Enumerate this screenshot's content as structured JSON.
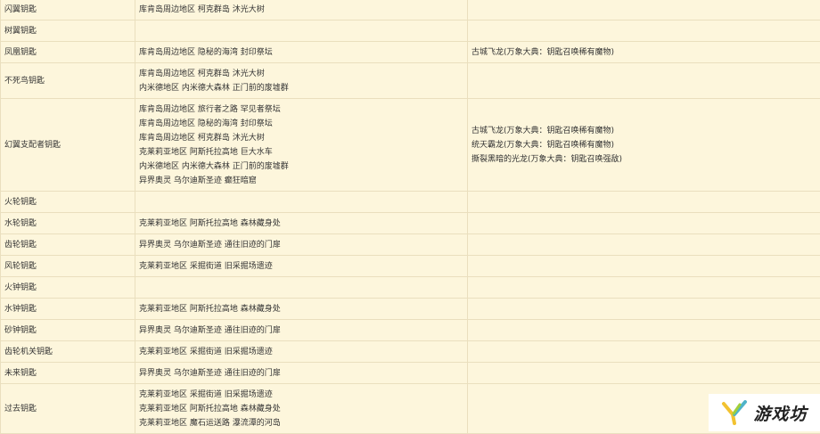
{
  "table": {
    "rows": [
      {
        "key": "闪翼钥匙",
        "locations": [
          "库肯岛周边地区 柯克群岛 沐光大树"
        ],
        "sources": []
      },
      {
        "key": "树翼钥匙",
        "locations": [],
        "sources": []
      },
      {
        "key": "凤凰钥匙",
        "locations": [
          "库肯岛周边地区 隐秘的海湾 封印祭坛"
        ],
        "sources": [
          "古城飞龙(万象大典：钥匙召唤稀有魔物)"
        ]
      },
      {
        "key": "不死鸟钥匙",
        "locations": [
          "库肯岛周边地区 柯克群岛 沐光大树",
          "内米德地区 内米德大森林 正门前的废墟群"
        ],
        "sources": []
      },
      {
        "key": "幻翼支配者钥匙",
        "locations": [
          "库肯岛周边地区 旅行者之路 罕见者祭坛",
          "库肯岛周边地区 隐秘的海湾 封印祭坛",
          "库肯岛周边地区 柯克群岛 沐光大树",
          "克莱莉亚地区 阿斯托拉高地 巨大水车",
          "内米德地区 内米德大森林 正门前的废墟群",
          "异界奥灵 乌尔迪斯圣迹 癫狂暗窟"
        ],
        "sources": [
          "古城飞龙(万象大典：钥匙召唤稀有魔物)",
          "统天霸龙(万象大典：钥匙召唤稀有魔物)",
          "撕裂黑暗的光龙(万象大典：钥匙召唤强敌)"
        ]
      },
      {
        "key": "火轮钥匙",
        "locations": [],
        "sources": []
      },
      {
        "key": "水轮钥匙",
        "locations": [
          "克莱莉亚地区 阿斯托拉高地 森林藏身处"
        ],
        "sources": []
      },
      {
        "key": "齿轮钥匙",
        "locations": [
          "异界奥灵 乌尔迪斯圣迹 通往旧迹的门扉"
        ],
        "sources": []
      },
      {
        "key": "风轮钥匙",
        "locations": [
          "克莱莉亚地区 采掘街道 旧采掘场遗迹"
        ],
        "sources": []
      },
      {
        "key": "火钟钥匙",
        "locations": [],
        "sources": []
      },
      {
        "key": "水钟钥匙",
        "locations": [
          "克莱莉亚地区 阿斯托拉高地 森林藏身处"
        ],
        "sources": []
      },
      {
        "key": "砂钟钥匙",
        "locations": [
          "异界奥灵 乌尔迪斯圣迹 通往旧迹的门扉"
        ],
        "sources": []
      },
      {
        "key": "齿轮机关钥匙",
        "locations": [
          "克莱莉亚地区 采掘街道 旧采掘场遗迹"
        ],
        "sources": []
      },
      {
        "key": "未来钥匙",
        "locations": [
          "异界奥灵 乌尔迪斯圣迹 通往旧迹的门扉"
        ],
        "sources": []
      },
      {
        "key": "过去钥匙",
        "locations": [
          "克莱莉亚地区 采掘街道 旧采掘场遗迹",
          "克莱莉亚地区 阿斯托拉高地 森林藏身处",
          "克莱莉亚地区 魔石运送路 瀑流潭的河岛"
        ],
        "sources": []
      }
    ]
  },
  "watermark": {
    "text": "游戏坊",
    "icon": "y-logo-icon"
  }
}
